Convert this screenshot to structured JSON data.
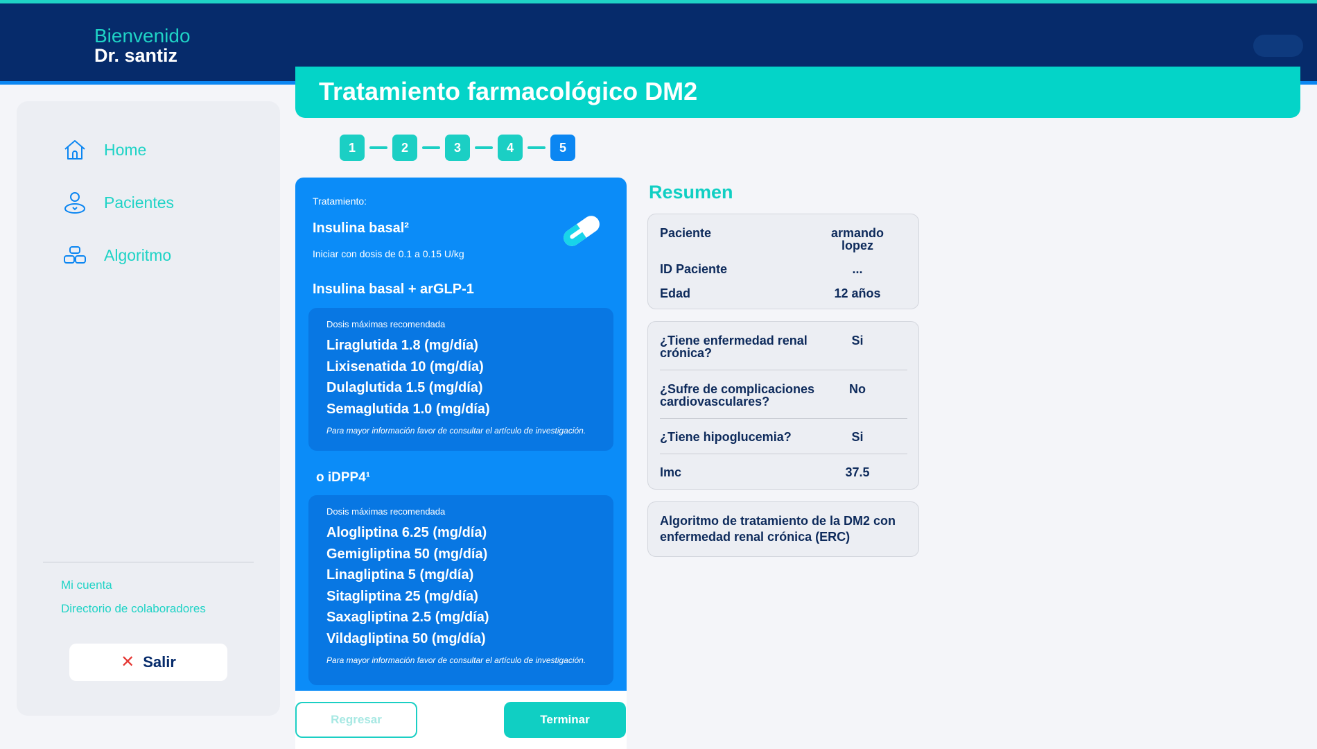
{
  "header": {
    "welcome": "Bienvenido",
    "doctor": "Dr. santiz"
  },
  "sidebar": {
    "items": [
      {
        "label": "Home",
        "icon": "home-icon"
      },
      {
        "label": "Pacientes",
        "icon": "patient-icon"
      },
      {
        "label": "Algoritmo",
        "icon": "algorithm-icon"
      }
    ],
    "links": [
      "Mi cuenta",
      "Directorio de colaboradores"
    ],
    "logout": "Salir"
  },
  "banner": {
    "title": "Tratamiento farmacológico DM2"
  },
  "stepper": {
    "steps": [
      "1",
      "2",
      "3",
      "4",
      "5"
    ],
    "active": 5
  },
  "treatment": {
    "label": "Tratamiento:",
    "name": "Insulina basal²",
    "dose": "Iniciar con dosis de 0.1 a 0.15 U/kg",
    "option1": "Insulina basal + arGLP-1",
    "box1": {
      "head": "Dosis máximas recomendada",
      "drugs": [
        "Liraglutida 1.8 (mg/día)",
        "Lixisenatida 10 (mg/día)",
        "Dulaglutida 1.5 (mg/día)",
        "Semaglutida 1.0 (mg/día)"
      ],
      "note": "Para mayor información favor de consultar el artículo de investigación."
    },
    "option2": "o iDPP4¹",
    "box2": {
      "head": "Dosis máximas recomendada",
      "drugs": [
        "Alogliptina 6.25 (mg/día)",
        "Gemigliptina 50 (mg/día)",
        "Linagliptina 5 (mg/día)",
        "Sitagliptina 25 (mg/día)",
        "Saxagliptina 2.5 (mg/día)",
        "Vildagliptina 50 (mg/día)"
      ],
      "note": "Para mayor información favor de consultar el artículo de investigación."
    }
  },
  "buttons": {
    "back": "Regresar",
    "finish": "Terminar"
  },
  "summary": {
    "title": "Resumen",
    "patient": [
      {
        "key": "Paciente",
        "value": "armando lopez"
      },
      {
        "key": "ID Paciente",
        "value": "..."
      },
      {
        "key": "Edad",
        "value": "12 años"
      }
    ],
    "questions": [
      {
        "key": "¿Tiene enfermedad renal crónica?",
        "value": "Si"
      },
      {
        "key": "¿Sufre de complicaciones cardiovasculares?",
        "value": "No"
      },
      {
        "key": "¿Tiene hipoglucemia?",
        "value": "Si"
      },
      {
        "key": "Imc",
        "value": "37.5"
      }
    ],
    "algorithm": "Algoritmo de tratamiento de la DM2 con enfermedad renal crónica (ERC)"
  },
  "colors": {
    "navy": "#062b6b",
    "teal": "#1fd3c6",
    "blue": "#0b8cf8",
    "danger": "#e53935"
  }
}
